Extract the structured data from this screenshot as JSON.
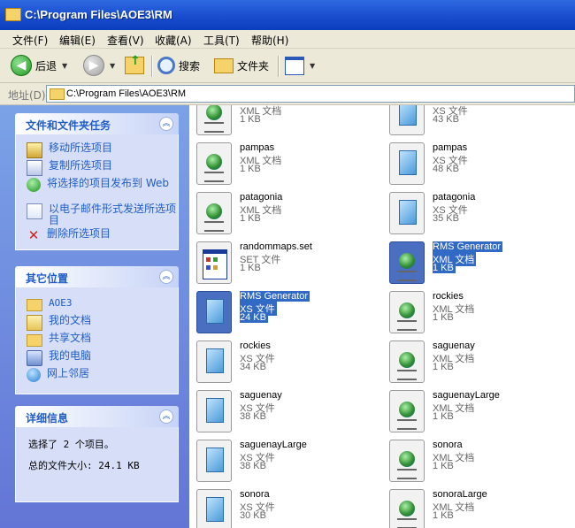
{
  "window": {
    "title": "C:\\Program Files\\AOE3\\RM"
  },
  "menu": [
    "文件(F)",
    "编辑(E)",
    "查看(V)",
    "收藏(A)",
    "工具(T)",
    "帮助(H)"
  ],
  "toolbar": {
    "back": "后退",
    "search": "搜索",
    "folders": "文件夹"
  },
  "address": {
    "label": "地址(D)",
    "path": "C:\\Program Files\\AOE3\\RM"
  },
  "tasks": {
    "title": "文件和文件夹任务",
    "items": [
      "移动所选项目",
      "复制所选项目",
      "将选择的项目发布到 Web",
      "以电子邮件形式发送所选项目",
      "删除所选项目"
    ]
  },
  "places": {
    "title": "其它位置",
    "items": [
      "AOE3",
      "我的文档",
      "共享文档",
      "我的电脑",
      "网上邻居"
    ]
  },
  "details": {
    "title": "详细信息",
    "selected": "选择了 2 个项目。",
    "total": "总的文件大小: 24.1 KB"
  },
  "files": [
    {
      "name": "",
      "type": "XML 文档",
      "size": "1 KB",
      "icon": "xml",
      "selected": false
    },
    {
      "name": "",
      "type": "XS 文件",
      "size": "43 KB",
      "icon": "xs",
      "selected": false
    },
    {
      "name": "pampas",
      "type": "XML 文档",
      "size": "1 KB",
      "icon": "xml",
      "selected": false
    },
    {
      "name": "pampas",
      "type": "XS 文件",
      "size": "48 KB",
      "icon": "xs",
      "selected": false
    },
    {
      "name": "patagonia",
      "type": "XML 文档",
      "size": "1 KB",
      "icon": "xml",
      "selected": false
    },
    {
      "name": "patagonia",
      "type": "XS 文件",
      "size": "35 KB",
      "icon": "xs",
      "selected": false
    },
    {
      "name": "randommaps.set",
      "type": "SET 文件",
      "size": "1 KB",
      "icon": "set",
      "selected": false
    },
    {
      "name": "RMS Generator",
      "type": "XML 文档",
      "size": "1 KB",
      "icon": "xml",
      "selected": true
    },
    {
      "name": "RMS Generator",
      "type": "XS 文件",
      "size": "24 KB",
      "icon": "xs",
      "selected": true
    },
    {
      "name": "rockies",
      "type": "XML 文档",
      "size": "1 KB",
      "icon": "xml",
      "selected": false
    },
    {
      "name": "rockies",
      "type": "XS 文件",
      "size": "34 KB",
      "icon": "xs",
      "selected": false
    },
    {
      "name": "saguenay",
      "type": "XML 文档",
      "size": "1 KB",
      "icon": "xml",
      "selected": false
    },
    {
      "name": "saguenay",
      "type": "XS 文件",
      "size": "38 KB",
      "icon": "xs",
      "selected": false
    },
    {
      "name": "saguenayLarge",
      "type": "XML 文档",
      "size": "1 KB",
      "icon": "xml",
      "selected": false
    },
    {
      "name": "saguenayLarge",
      "type": "XS 文件",
      "size": "38 KB",
      "icon": "xs",
      "selected": false
    },
    {
      "name": "sonora",
      "type": "XML 文档",
      "size": "1 KB",
      "icon": "xml",
      "selected": false
    },
    {
      "name": "sonora",
      "type": "XS 文件",
      "size": "30 KB",
      "icon": "xs",
      "selected": false
    },
    {
      "name": "sonoraLarge",
      "type": "XML 文档",
      "size": "1 KB",
      "icon": "xml",
      "selected": false
    }
  ]
}
